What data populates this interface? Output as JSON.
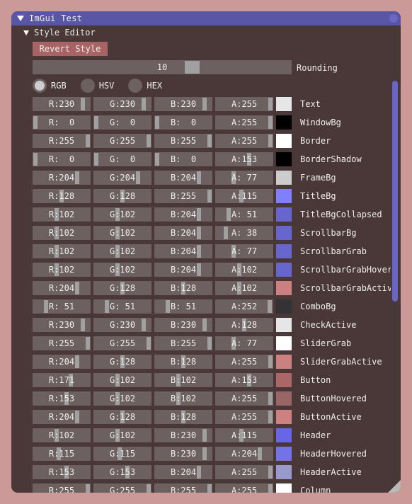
{
  "window": {
    "title": "ImGui Test"
  },
  "tree": {
    "label": "Style Editor"
  },
  "revert": {
    "label": "Revert Style"
  },
  "rounding": {
    "value": "10",
    "label": "Rounding",
    "fraction": 0.6
  },
  "modes": [
    {
      "label": "RGB",
      "selected": true
    },
    {
      "label": "HSV",
      "selected": false
    },
    {
      "label": "HEX",
      "selected": false
    }
  ],
  "colors": [
    {
      "name": "Text",
      "r": 230,
      "g": 230,
      "b": 230,
      "a": 255,
      "swatch": "#e6e6e6"
    },
    {
      "name": "WindowBg",
      "r": 0,
      "g": 0,
      "b": 0,
      "a": 255,
      "swatch": "#000000"
    },
    {
      "name": "Border",
      "r": 255,
      "g": 255,
      "b": 255,
      "a": 255,
      "swatch": "#ffffff"
    },
    {
      "name": "BorderShadow",
      "r": 0,
      "g": 0,
      "b": 0,
      "a": 153,
      "swatch": "#000000"
    },
    {
      "name": "FrameBg",
      "r": 204,
      "g": 204,
      "b": 204,
      "a": 77,
      "swatch": "#cccccc"
    },
    {
      "name": "TitleBg",
      "r": 128,
      "g": 128,
      "b": 255,
      "a": 115,
      "swatch": "#8080ff"
    },
    {
      "name": "TitleBgCollapsed",
      "r": 102,
      "g": 102,
      "b": 204,
      "a": 51,
      "swatch": "#6666cc"
    },
    {
      "name": "ScrollbarBg",
      "r": 102,
      "g": 102,
      "b": 204,
      "a": 38,
      "swatch": "#6666cc"
    },
    {
      "name": "ScrollbarGrab",
      "r": 102,
      "g": 102,
      "b": 204,
      "a": 77,
      "swatch": "#6666cc"
    },
    {
      "name": "ScrollbarGrabHovered",
      "r": 102,
      "g": 102,
      "b": 204,
      "a": 102,
      "swatch": "#6666cc"
    },
    {
      "name": "ScrollbarGrabActive",
      "r": 204,
      "g": 128,
      "b": 128,
      "a": 102,
      "swatch": "#cc8080"
    },
    {
      "name": "ComboBg",
      "r": 51,
      "g": 51,
      "b": 51,
      "a": 252,
      "swatch": "#333333"
    },
    {
      "name": "CheckActive",
      "r": 230,
      "g": 230,
      "b": 230,
      "a": 128,
      "swatch": "#e6e6e6"
    },
    {
      "name": "SliderGrab",
      "r": 255,
      "g": 255,
      "b": 255,
      "a": 77,
      "swatch": "#ffffff"
    },
    {
      "name": "SliderGrabActive",
      "r": 204,
      "g": 128,
      "b": 128,
      "a": 255,
      "swatch": "#cc8080"
    },
    {
      "name": "Button",
      "r": 171,
      "g": 102,
      "b": 102,
      "a": 153,
      "swatch": "#ab6666"
    },
    {
      "name": "ButtonHovered",
      "r": 153,
      "g": 102,
      "b": 102,
      "a": 255,
      "swatch": "#996666"
    },
    {
      "name": "ButtonActive",
      "r": 204,
      "g": 128,
      "b": 128,
      "a": 255,
      "swatch": "#cc8080"
    },
    {
      "name": "Header",
      "r": 102,
      "g": 102,
      "b": 230,
      "a": 115,
      "swatch": "#6666e6"
    },
    {
      "name": "HeaderHovered",
      "r": 115,
      "g": 115,
      "b": 230,
      "a": 204,
      "swatch": "#7373e6"
    },
    {
      "name": "HeaderActive",
      "r": 153,
      "g": 153,
      "b": 204,
      "a": 255,
      "swatch": "#9999cc"
    },
    {
      "name": "Column",
      "r": 255,
      "g": 255,
      "b": 255,
      "a": 255,
      "swatch": "#ffffff"
    }
  ]
}
